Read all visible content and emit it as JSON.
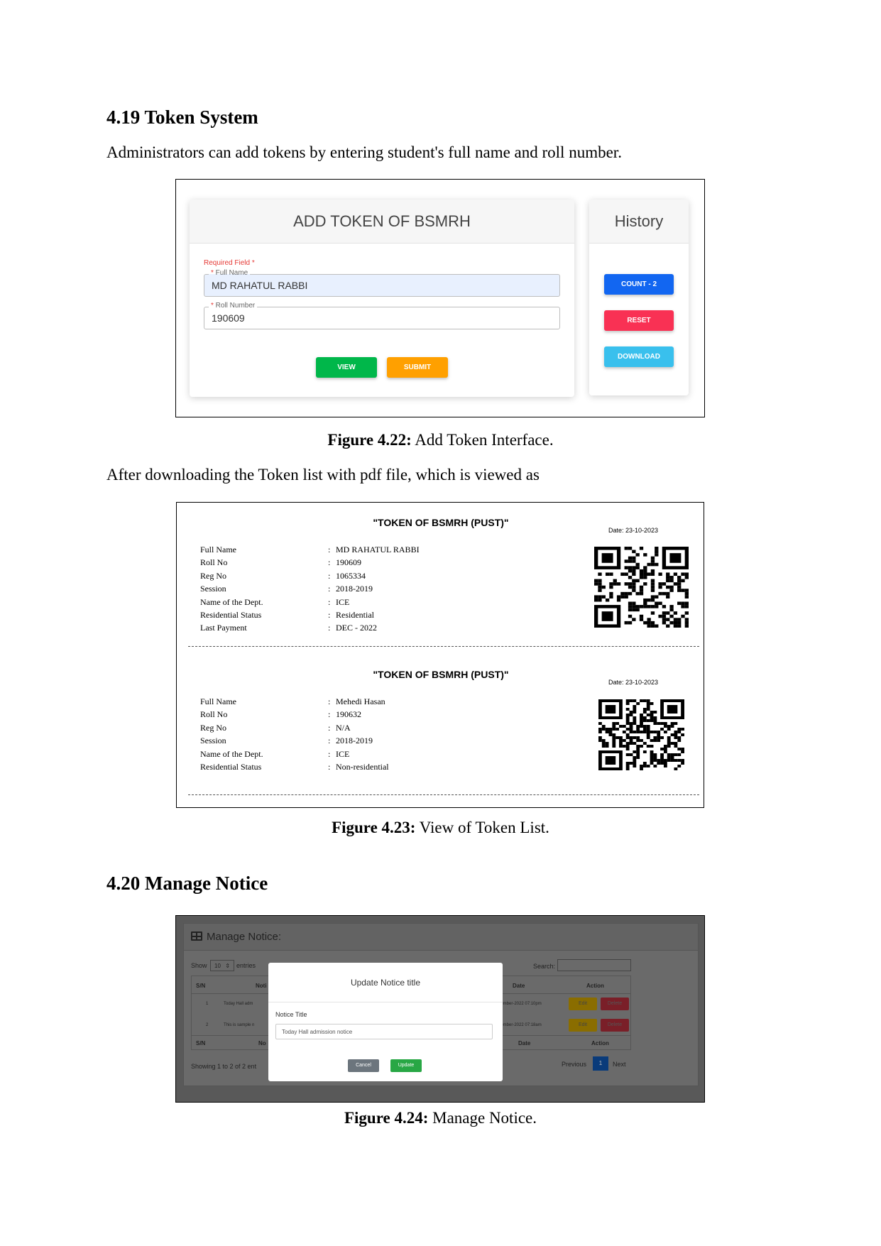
{
  "section1": {
    "heading": "4.19 Token System",
    "intro": "Administrators can add tokens by entering student's full name and roll number."
  },
  "fig_add_token": {
    "title": "ADD TOKEN OF BSMRH",
    "required_text": "Required Field *",
    "full_name_label": "Full Name",
    "full_name_value": "MD RAHATUL RABBI",
    "roll_label": "Roll Number",
    "roll_value": "190609",
    "view_button": "VIEW",
    "submit_button": "SUBMIT",
    "history_title": "History",
    "count_button": "COUNT - 2",
    "reset_button": "RESET",
    "download_button": "DOWNLOAD",
    "colors": {
      "view": "#00b74a",
      "submit": "#ffa000",
      "count": "#1266f1",
      "reset": "#f93154",
      "download": "#39c0ed"
    }
  },
  "caption_422": {
    "label": "Figure 4.22:",
    "text": " Add Token Interface."
  },
  "transition": "After downloading the Token list with pdf file, which is viewed as",
  "fig_token_list": {
    "tokens": [
      {
        "title": "\"TOKEN OF BSMRH (PUST)\"",
        "date": "Date: 23-10-2023",
        "fields": [
          {
            "label": "Full Name",
            "value": "MD RAHATUL RABBI"
          },
          {
            "label": "Roll No",
            "value": "190609"
          },
          {
            "label": "Reg No",
            "value": "1065334"
          },
          {
            "label": "Session",
            "value": "2018-2019"
          },
          {
            "label": "Name of the Dept.",
            "value": "ICE"
          },
          {
            "label": "Residential Status",
            "value": "Residential"
          },
          {
            "label": "Last Payment",
            "value": "DEC - 2022"
          }
        ]
      },
      {
        "title": "\"TOKEN OF BSMRH (PUST)\"",
        "date": "Date: 23-10-2023",
        "fields": [
          {
            "label": "Full Name",
            "value": "Mehedi Hasan"
          },
          {
            "label": "Roll No",
            "value": "190632"
          },
          {
            "label": "Reg No",
            "value": "N/A"
          },
          {
            "label": "Session",
            "value": "2018-2019"
          },
          {
            "label": "Name of the Dept.",
            "value": "ICE"
          },
          {
            "label": "Residential Status",
            "value": "Non-residential"
          }
        ]
      }
    ]
  },
  "caption_423": {
    "label": "Figure 4.23:",
    "text": " View of Token List."
  },
  "section2": {
    "heading": "4.20 Manage Notice"
  },
  "fig_manage_notice": {
    "panel_title": "Manage Notice:",
    "show_label": "Show",
    "entries_value": "10",
    "entries_label": "entries",
    "search_label": "Search:",
    "col_sn": "S/N",
    "col_notice": "Noti",
    "col_date": "Date",
    "col_action": "Action",
    "rows": [
      {
        "sn": "1",
        "notice": "Today Hall adm",
        "date": "10-December-2022 07:10pm"
      },
      {
        "sn": "2",
        "notice": "This is sample n",
        "date": "20-November-2022 07:18am"
      }
    ],
    "edit_label": "Edit",
    "delete_label": "Delete",
    "footer_sn": "S/N",
    "footer_notice": "No",
    "footer_date": "Date",
    "footer_action": "Action",
    "showing_text": "Showing 1 to 2 of 2 ent",
    "prev_label": "Previous",
    "page_label": "1",
    "next_label": "Next",
    "modal": {
      "title": "Update Notice title",
      "field_label": "Notice Title",
      "field_value": "Today Hall admission notice",
      "cancel": "Cancel",
      "update": "Update"
    }
  },
  "caption_424": {
    "label": "Figure 4.24:",
    "text": " Manage Notice."
  }
}
